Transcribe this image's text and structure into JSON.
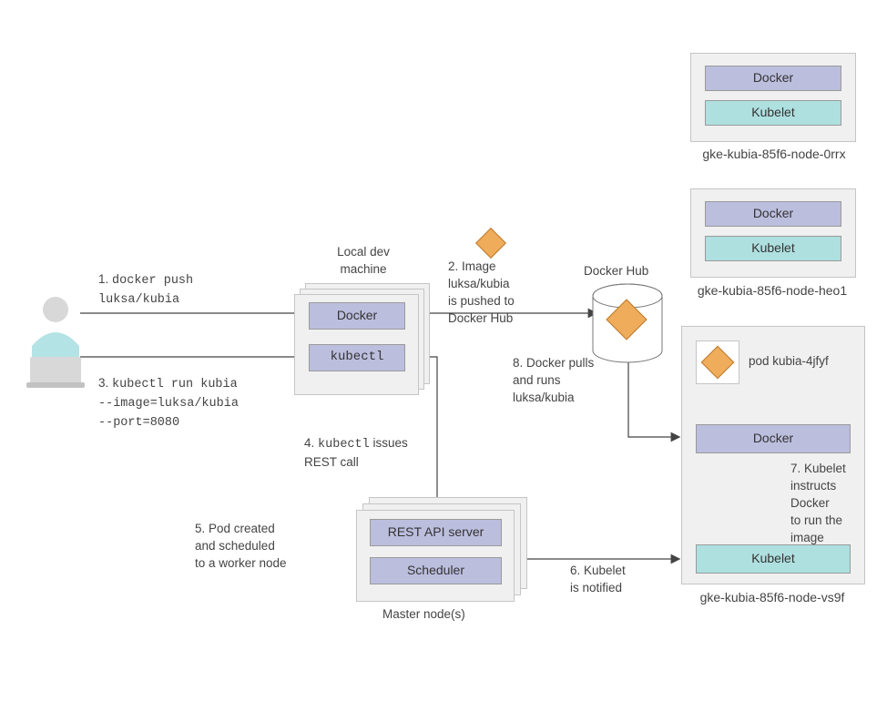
{
  "labels": {
    "local_dev": "Local dev\nmachine",
    "docker_hub": "Docker Hub",
    "master_nodes": "Master node(s)"
  },
  "steps": {
    "s1_pre": "1. ",
    "s1_cmd": "docker push\nluksa/kubia",
    "s2": "2. Image\nluksa/kubia\nis pushed to\nDocker Hub",
    "s3_pre": "3. ",
    "s3_cmd": "kubectl run kubia\n--image=luksa/kubia\n--port=8080",
    "s4_pre": "4. ",
    "s4_cmd": "kubectl",
    "s4_post": " issues\nREST call",
    "s5": "5. Pod created\nand scheduled\nto a worker node",
    "s6": "6. Kubelet\nis notified",
    "s7": "7. Kubelet\ninstructs\nDocker\nto run the\nimage",
    "s8": "8. Docker pulls\nand runs\nluksa/kubia"
  },
  "chips": {
    "docker": "Docker",
    "kubectl": "kubectl",
    "kubelet": "Kubelet",
    "rest_api": "REST API server",
    "scheduler": "Scheduler"
  },
  "nodes": {
    "n1": "gke-kubia-85f6-node-0rrx",
    "n2": "gke-kubia-85f6-node-heo1",
    "n3": "gke-kubia-85f6-node-vs9f"
  },
  "pod_label": "pod kubia-4jfyf"
}
